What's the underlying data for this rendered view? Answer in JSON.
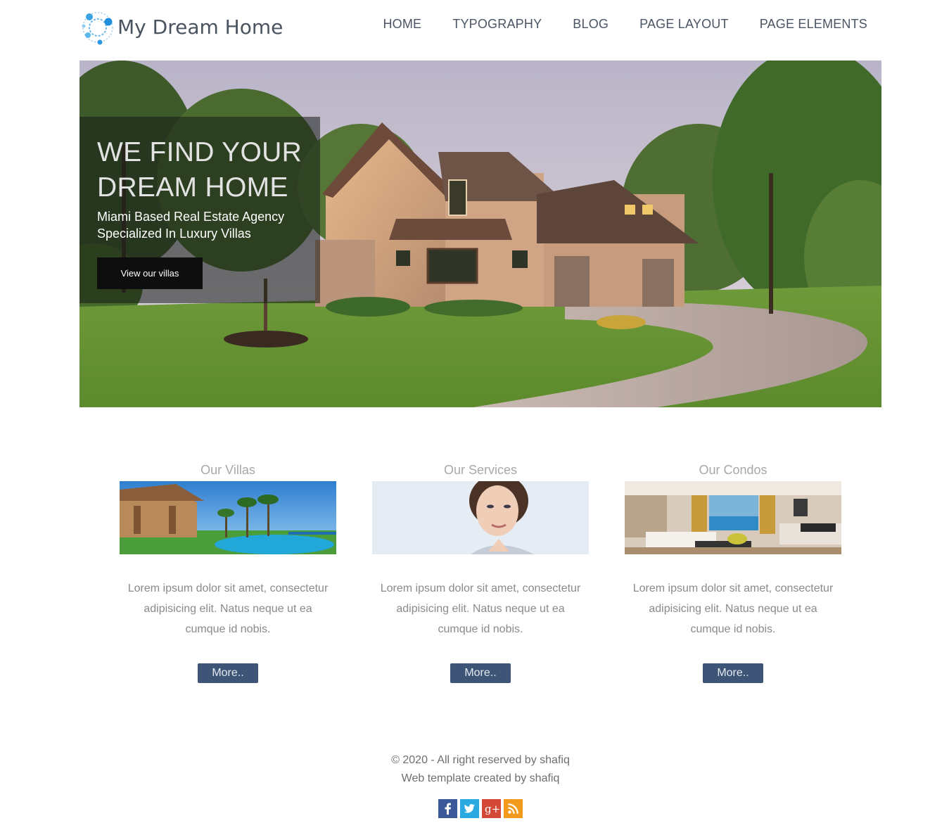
{
  "header": {
    "logo_text": "My Dream Home",
    "nav": [
      "HOME",
      "TYPOGRAPHY",
      "BLOG",
      "PAGE LAYOUT",
      "PAGE ELEMENTS"
    ]
  },
  "hero": {
    "title_line1": "WE FIND YOUR",
    "title_line2": "DREAM HOME",
    "subtitle_line1": "Miami Based Real Estate Agency",
    "subtitle_line2": "Specialized In Luxury Villas",
    "button_label": "View our villas"
  },
  "features": [
    {
      "title": "Our Villas",
      "text": "Lorem ipsum dolor sit amet, consectetur adipisicing elit. Natus neque ut ea cumque id nobis.",
      "button": "More.."
    },
    {
      "title": "Our Services",
      "text": "Lorem ipsum dolor sit amet, consectetur adipisicing elit. Natus neque ut ea cumque id nobis.",
      "button": "More.."
    },
    {
      "title": "Our Condos",
      "text": "Lorem ipsum dolor sit amet, consectetur adipisicing elit. Natus neque ut ea cumque id nobis.",
      "button": "More.."
    }
  ],
  "footer": {
    "copyright": "© 2020 - All right reserved by shafiq",
    "credit": "Web template created by shafiq",
    "social": [
      "facebook-icon",
      "twitter-icon",
      "google-plus-icon",
      "rss-icon"
    ]
  },
  "colors": {
    "nav_text": "#4b5563",
    "button_blue": "#3f5577",
    "facebook": "#3b5998",
    "twitter": "#2ba9e1",
    "google_plus": "#d34836",
    "rss": "#f29a1b"
  }
}
